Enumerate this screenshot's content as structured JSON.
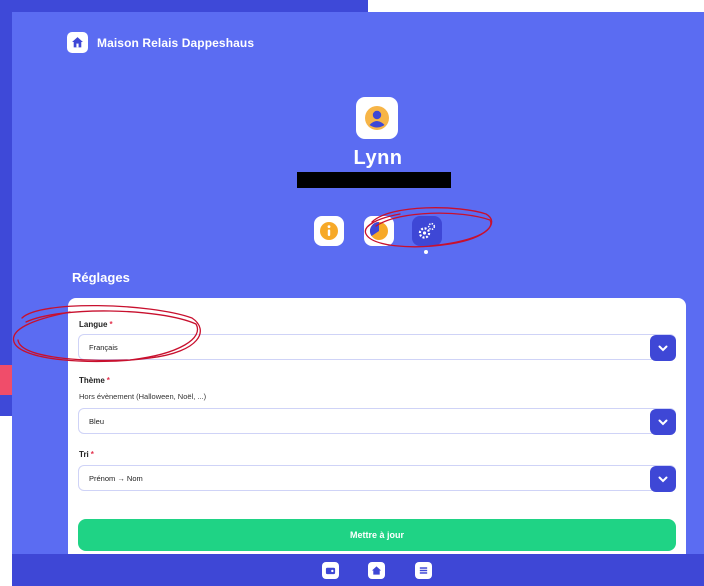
{
  "app": {
    "title": "Maison Relais Dappeshaus",
    "logo_icon": "home-icon"
  },
  "profile": {
    "name": "Lynn"
  },
  "tabs": [
    {
      "icon": "info-icon"
    },
    {
      "icon": "pie-chart-icon"
    },
    {
      "icon": "gears-icon",
      "active": true
    }
  ],
  "settings": {
    "title": "Réglages",
    "required_marker": "*",
    "language": {
      "label": "Langue",
      "value": "Français"
    },
    "theme": {
      "label": "Thème",
      "sublabel": "Hors évènement (Halloween, Noël, ...)",
      "value": "Bleu"
    },
    "sort": {
      "label": "Tri",
      "value": "Prénom → Nom"
    },
    "submit_label": "Mettre à jour"
  },
  "bottom_nav": [
    {
      "icon": "wallet-icon"
    },
    {
      "icon": "home-icon"
    },
    {
      "icon": "menu-icon"
    }
  ],
  "colors": {
    "primary": "#5b6cf2",
    "primary_dark": "#3e47d6",
    "accent_green": "#1fd385",
    "required_red": "#e3344f",
    "annotation_red": "#c8102e"
  }
}
